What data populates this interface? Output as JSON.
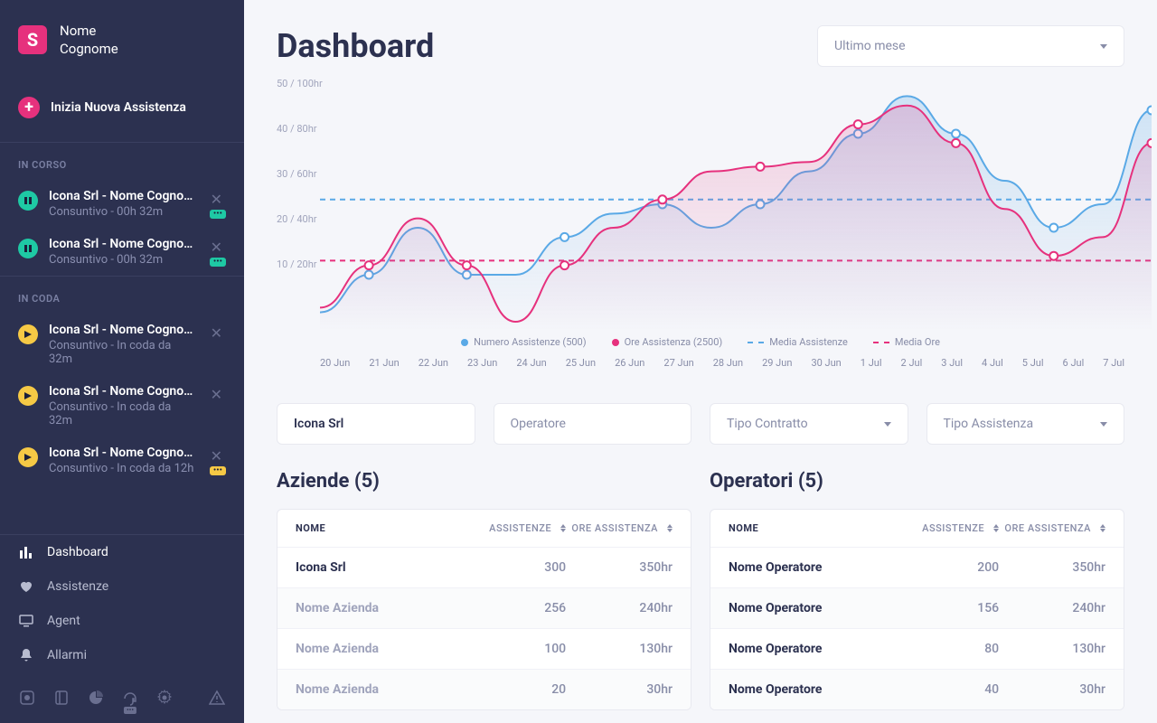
{
  "user": {
    "initial": "S",
    "first": "Nome",
    "last": "Cognome"
  },
  "sidebar": {
    "new_assist": "Inizia Nuova Assistenza",
    "section_in_corso": "IN CORSO",
    "section_in_coda": "IN CODA",
    "in_corso": [
      {
        "title": "Icona Srl - Nome Cognome",
        "sub": "Consuntivo - 00h 32m"
      },
      {
        "title": "Icona Srl - Nome Cognome",
        "sub": "Consuntivo - 00h 32m"
      }
    ],
    "in_coda": [
      {
        "title": "Icona Srl - Nome Cognome",
        "sub": "Consuntivo - In coda da 32m"
      },
      {
        "title": "Icona Srl - Nome Cognome",
        "sub": "Consuntivo - In coda da 32m"
      },
      {
        "title": "Icona Srl - Nome Cognome",
        "sub": "Consuntivo - In coda da 12h"
      }
    ],
    "nav": {
      "dashboard": "Dashboard",
      "assistenze": "Assistenze",
      "agent": "Agent",
      "allarmi": "Allarmi"
    }
  },
  "header": {
    "title": "Dashboard",
    "range": "Ultimo mese"
  },
  "chart_data": {
    "type": "line",
    "y_ticks": [
      "50 / 100hr",
      "40 / 80hr",
      "30 / 60hr",
      "20 / 40hr",
      "10 / 20hr"
    ],
    "categories": [
      "20 Jun",
      "21 Jun",
      "22 Jun",
      "23 Jun",
      "24 Jun",
      "25 Jun",
      "26 Jun",
      "27 Jun",
      "28 Jun",
      "29 Jun",
      "30 Jun",
      "1 Jul",
      "2 Jul",
      "3 Jul",
      "4 Jul",
      "5 Jul",
      "6 Jul",
      "7 Jul"
    ],
    "series": [
      {
        "name": "Numero Assistenze (500)",
        "color": "#5aa9e6",
        "values": [
          2,
          10,
          20,
          10,
          10,
          18,
          23,
          25,
          20,
          25,
          32,
          40,
          48,
          40,
          30,
          20,
          25,
          45
        ],
        "show_points_at": [
          1,
          3,
          5,
          7,
          9,
          11,
          13,
          15,
          17
        ]
      },
      {
        "name": "Ore Assistenza (2500)",
        "color": "#e6317d",
        "values": [
          3,
          12,
          22,
          12,
          0,
          12,
          20,
          26,
          32,
          33,
          34,
          42,
          46,
          38,
          24,
          14,
          18,
          38
        ],
        "show_points_at": [
          1,
          3,
          5,
          7,
          9,
          11,
          13,
          15,
          17
        ]
      }
    ],
    "ylim": [
      0,
      50
    ],
    "reference_lines": [
      {
        "name": "Media Assistenze",
        "color": "#5aa9e6",
        "value": 26
      },
      {
        "name": "Media Ore",
        "color": "#e6317d",
        "value": 13
      }
    ],
    "legend": [
      "Numero Assistenze (500)",
      "Ore Assistenza (2500)",
      "Media Assistenze",
      "Media Ore"
    ]
  },
  "filters": {
    "azienda_value": "Icona Srl",
    "operatore_placeholder": "Operatore",
    "tipo_contratto": "Tipo Contratto",
    "tipo_assistenza": "Tipo Assistenza"
  },
  "tables": {
    "aziende_title": "Aziende (5)",
    "operatori_title": "Operatori (5)",
    "headers": {
      "nome": "NOME",
      "assistenze": "ASSISTENZE",
      "ore": "ORE ASSISTENZA"
    },
    "aziende": [
      {
        "nome": "Icona Srl",
        "assistenze": "300",
        "ore": "350hr"
      },
      {
        "nome": "Nome Azienda",
        "assistenze": "256",
        "ore": "240hr"
      },
      {
        "nome": "Nome Azienda",
        "assistenze": "100",
        "ore": "130hr"
      },
      {
        "nome": "Nome Azienda",
        "assistenze": "20",
        "ore": "30hr"
      }
    ],
    "operatori": [
      {
        "nome": "Nome Operatore",
        "assistenze": "200",
        "ore": "350hr"
      },
      {
        "nome": "Nome Operatore",
        "assistenze": "156",
        "ore": "240hr"
      },
      {
        "nome": "Nome Operatore",
        "assistenze": "80",
        "ore": "130hr"
      },
      {
        "nome": "Nome Operatore",
        "assistenze": "40",
        "ore": "30hr"
      }
    ]
  }
}
